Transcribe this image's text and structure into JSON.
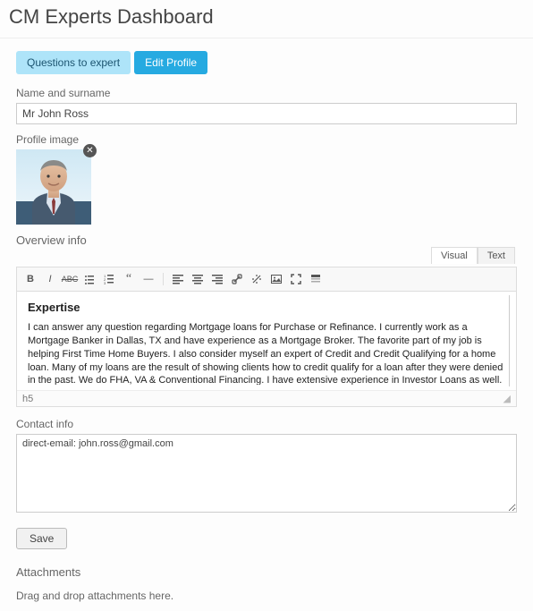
{
  "page_title": "CM Experts Dashboard",
  "tabs": {
    "questions_label": "Questions to expert",
    "edit_label": "Edit Profile"
  },
  "form": {
    "name_label": "Name and surname",
    "name_value": "Mr John Ross",
    "profile_image_label": "Profile image",
    "close_icon": "✕",
    "overview_label": "Overview info",
    "contact_label": "Contact info",
    "contact_value": "direct-email: john.ross@gmail.com",
    "save_label": "Save",
    "attachments_label": "Attachments",
    "dragdrop_text": "Drag and drop attachments here."
  },
  "editor": {
    "tabs": {
      "visual": "Visual",
      "text": "Text"
    },
    "heading": "Expertise",
    "body": "I can answer any question regarding Mortgage loans for Purchase or Refinance. I currently work as a Mortgage Banker in Dallas, TX and have experience as a Mortgage Broker. The favorite part of my job is helping First Time Home Buyers. I also consider myself an expert of Credit and Credit Qualifying for a home loan. Many of my loans are the result of showing clients how to credit qualify for a loan after they were denied in the past. We do FHA, VA & Conventional Financing. I have extensive experience in Investor Loans as well. I will NOT answer questions about 'getting around guidelines', etc. Or if I sense that you",
    "status_element": "h5"
  }
}
